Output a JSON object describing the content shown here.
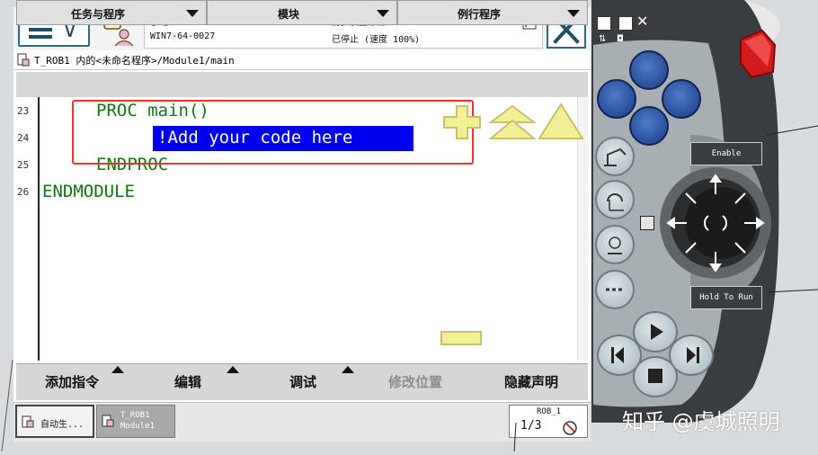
{
  "header": {
    "mode": "手动",
    "controller": "WIN7-64-0027",
    "safety_status": "防护装置停止",
    "run_status": "已停止 (速度 100%)"
  },
  "path": "T_ROB1 内的<未命名程序>/Module1/main",
  "columns": {
    "tasks": "任务与程序",
    "modules": "模块",
    "routines": "例行程序"
  },
  "code_lines": [
    {
      "num": "23",
      "text": "PROC main()"
    },
    {
      "num": "24",
      "text": "!Add your code here"
    },
    {
      "num": "25",
      "text": "ENDPROC"
    },
    {
      "num": "26",
      "text": "ENDMODULE"
    }
  ],
  "bottom_menu": {
    "add_instruction": "添加指令",
    "edit": "编辑",
    "debug": "调试",
    "modify_position": "修改位置",
    "hide_declarations": "隐藏声明"
  },
  "taskbar": {
    "auto_label": "自动生...",
    "task_line1": "T_ROB1",
    "task_line2": "Module1",
    "robot": "ROB_1",
    "fraction": "1/3"
  },
  "pendant": {
    "enable": "Enable",
    "hold_to_run": "Hold To Run"
  },
  "watermark": "知乎 @虞城照明",
  "colors": {
    "code_green": "#137313",
    "highlight_blue": "#0000ee",
    "annotation_red": "#e8342a",
    "overlay_yellow": "#f3ef95"
  }
}
